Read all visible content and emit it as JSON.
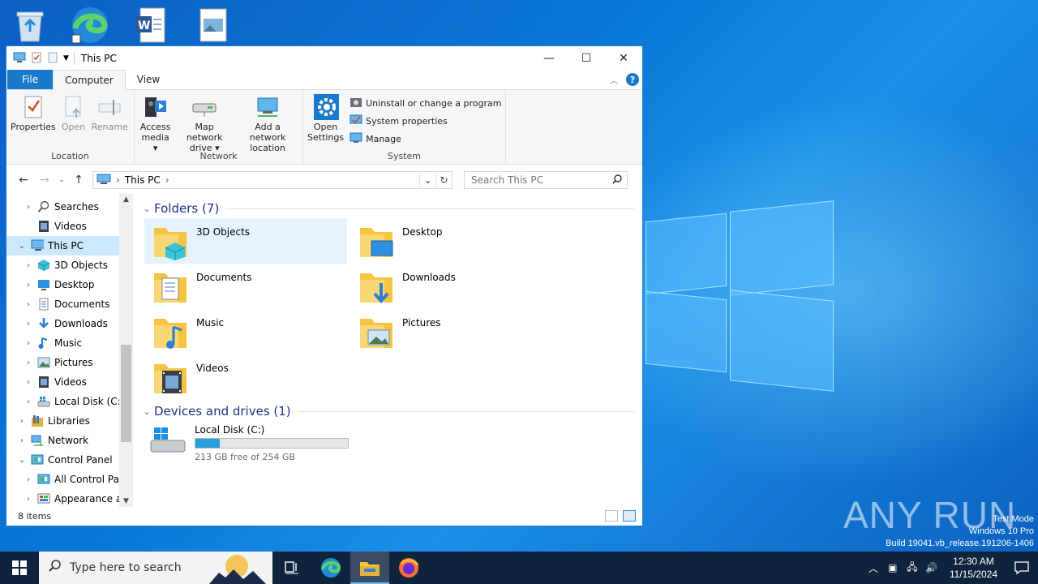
{
  "window": {
    "title": "This PC",
    "controls": {
      "minimize": "—",
      "maximize": "☐",
      "close": "✕"
    }
  },
  "ribbon": {
    "tabs": [
      "File",
      "Computer",
      "View"
    ],
    "active_tab": "Computer",
    "help": "?",
    "groups": {
      "location": {
        "label": "Location",
        "buttons": [
          "Properties",
          "Open",
          "Rename"
        ]
      },
      "network": {
        "label": "Network",
        "access_media": [
          "Access",
          "media ▾"
        ],
        "map_drive": [
          "Map network",
          "drive ▾"
        ],
        "add_location": [
          "Add a network",
          "location"
        ]
      },
      "system": {
        "label": "System",
        "open_settings": [
          "Open",
          "Settings"
        ],
        "items": [
          "Uninstall or change a program",
          "System properties",
          "Manage"
        ]
      }
    }
  },
  "address": {
    "path": "This PC",
    "separator": "›",
    "search_placeholder": "Search This PC"
  },
  "nav_tree": [
    {
      "label": "Searches",
      "icon": "search-icon",
      "expander": "›",
      "indent": 1
    },
    {
      "label": "Videos",
      "icon": "video-icon",
      "expander": "",
      "indent": 1
    },
    {
      "label": "This PC",
      "icon": "computer-icon",
      "expander": "⌄",
      "indent": 0,
      "selected": true
    },
    {
      "label": "3D Objects",
      "icon": "cube-icon",
      "expander": "›",
      "indent": 1
    },
    {
      "label": "Desktop",
      "icon": "desktop-icon",
      "expander": "›",
      "indent": 1
    },
    {
      "label": "Documents",
      "icon": "document-icon",
      "expander": "›",
      "indent": 1
    },
    {
      "label": "Downloads",
      "icon": "download-icon",
      "expander": "›",
      "indent": 1
    },
    {
      "label": "Music",
      "icon": "music-icon",
      "expander": "›",
      "indent": 1
    },
    {
      "label": "Pictures",
      "icon": "picture-icon",
      "expander": "›",
      "indent": 1
    },
    {
      "label": "Videos",
      "icon": "video-icon",
      "expander": "›",
      "indent": 1
    },
    {
      "label": "Local Disk (C:)",
      "icon": "drive-icon",
      "expander": "›",
      "indent": 1
    },
    {
      "label": "Libraries",
      "icon": "library-icon",
      "expander": "›",
      "indent": 0
    },
    {
      "label": "Network",
      "icon": "network-icon",
      "expander": "›",
      "indent": 0
    },
    {
      "label": "Control Panel",
      "icon": "control-panel-icon",
      "expander": "⌄",
      "indent": 0
    },
    {
      "label": "All Control Par",
      "icon": "control-panel-icon",
      "expander": "›",
      "indent": 1
    },
    {
      "label": "Appearance an",
      "icon": "appearance-icon",
      "expander": "›",
      "indent": 1
    }
  ],
  "content": {
    "folders_header": "Folders (7)",
    "folders": [
      {
        "name": "3D Objects",
        "icon": "cube",
        "selected": true
      },
      {
        "name": "Desktop",
        "icon": "desktop"
      },
      {
        "name": "Documents",
        "icon": "document"
      },
      {
        "name": "Downloads",
        "icon": "download"
      },
      {
        "name": "Music",
        "icon": "music"
      },
      {
        "name": "Pictures",
        "icon": "picture"
      },
      {
        "name": "Videos",
        "icon": "video"
      }
    ],
    "drives_header": "Devices and drives (1)",
    "drive": {
      "name": "Local Disk (C:)",
      "free_text": "213 GB free of 254 GB",
      "used_fraction": 0.161
    }
  },
  "status": {
    "items": "8 items"
  },
  "taskbar": {
    "search_placeholder": "Type here to search",
    "clock_time": "12:30 AM",
    "clock_date": "11/15/2024"
  },
  "watermark": {
    "brand": "ANY RUN",
    "line1": "Test Mode",
    "line2": "Windows 10 Pro",
    "line3": "Build 19041.vb_release.191206-1406"
  },
  "colors": {
    "accent": "#1979ca",
    "selection": "#cce8ff",
    "drive_fill": "#26a0da",
    "section_header": "#1e3287"
  }
}
